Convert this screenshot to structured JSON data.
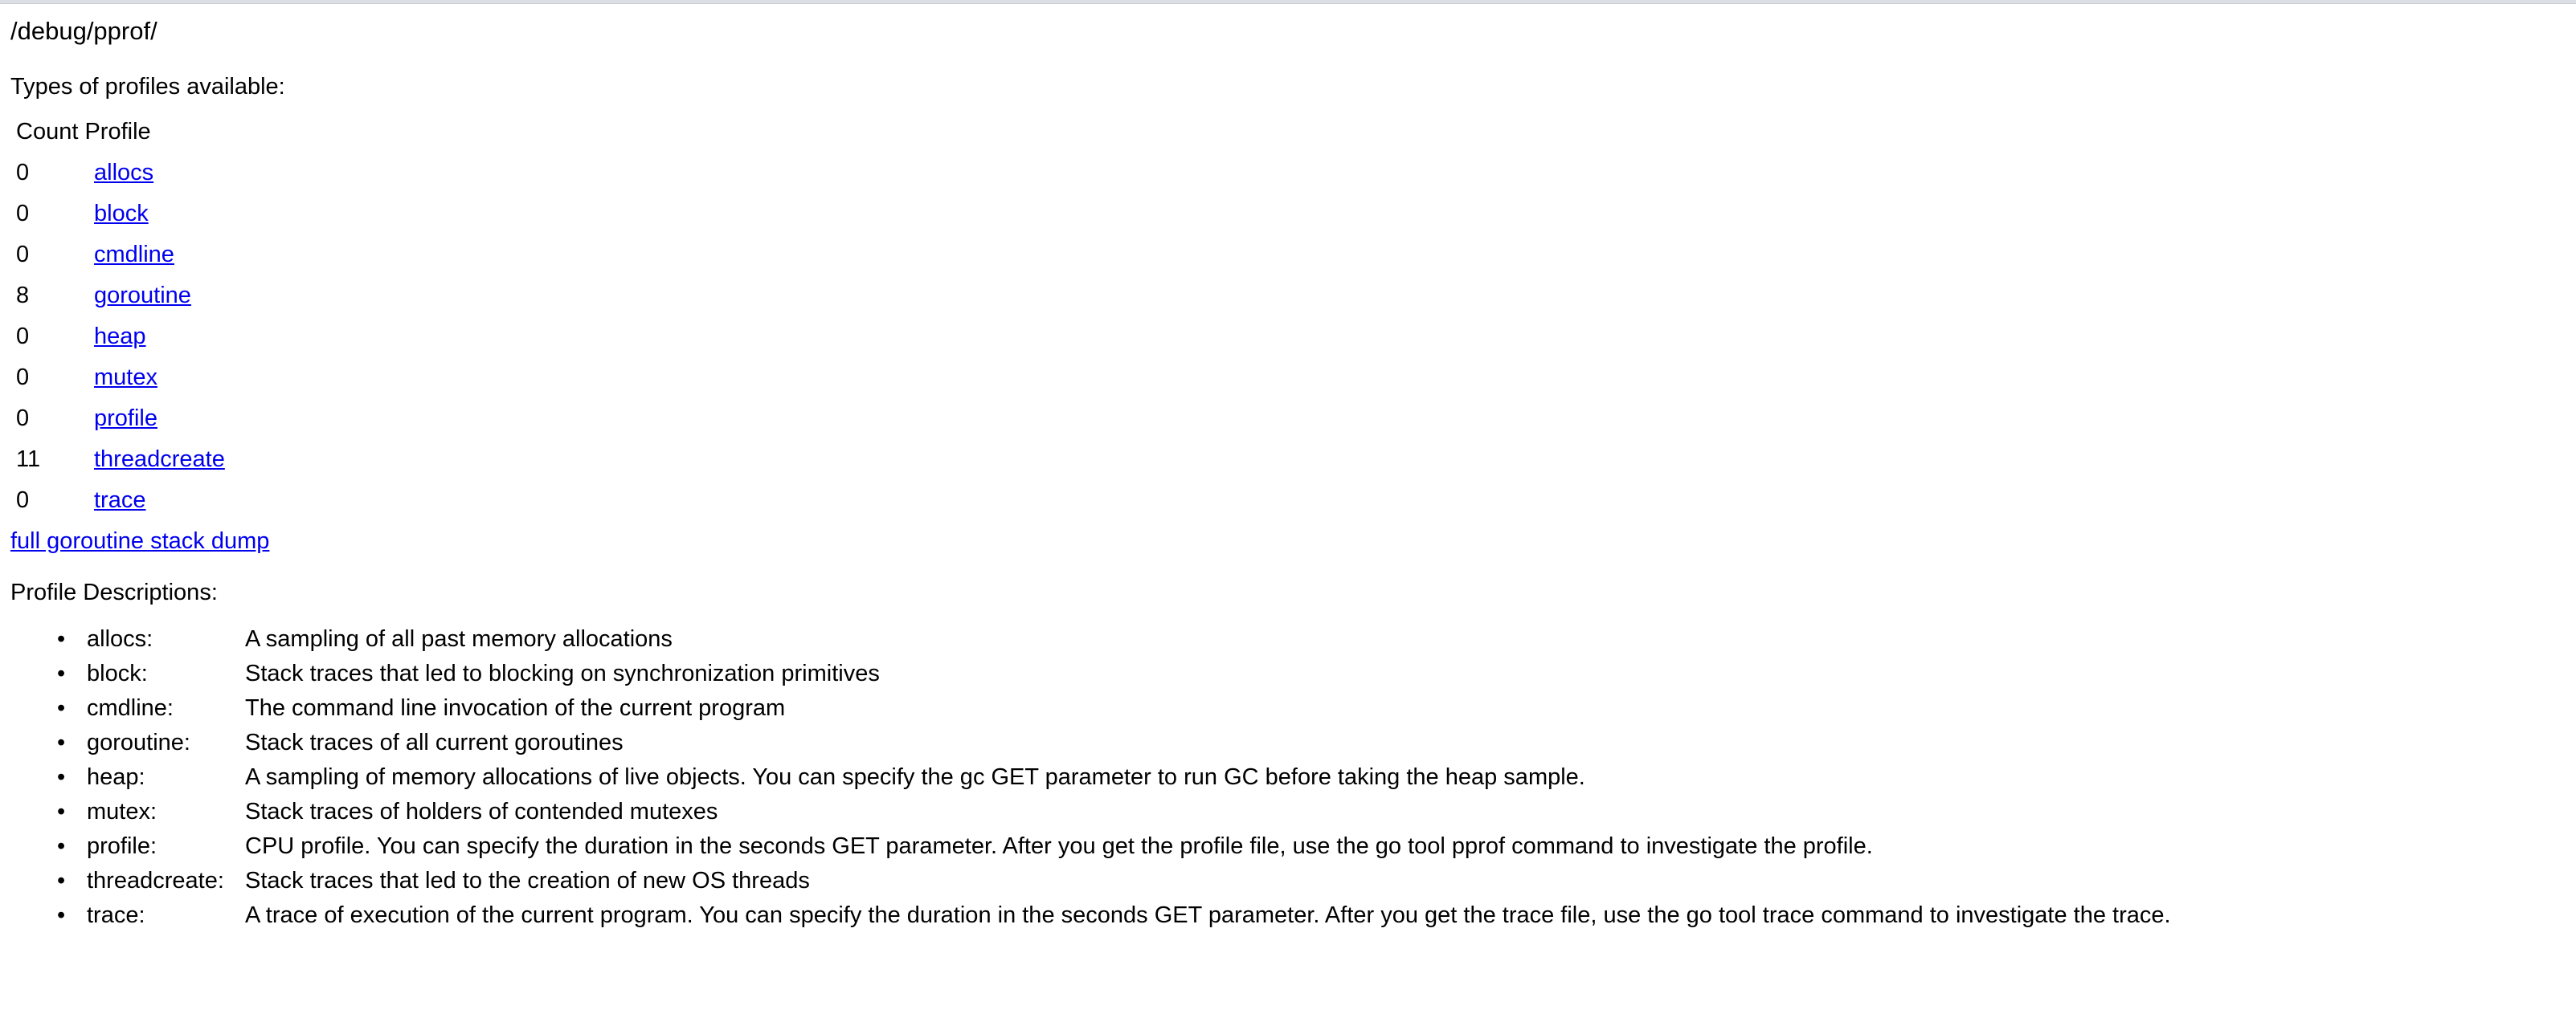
{
  "page": {
    "heading": "/debug/pprof/",
    "types_label": "Types of profiles available:",
    "descriptions_label": "Profile Descriptions:"
  },
  "profile_table": {
    "header": "Count Profile",
    "rows": [
      {
        "count": "0",
        "profile": "allocs"
      },
      {
        "count": "0",
        "profile": "block"
      },
      {
        "count": "0",
        "profile": "cmdline"
      },
      {
        "count": "8",
        "profile": "goroutine"
      },
      {
        "count": "0",
        "profile": "heap"
      },
      {
        "count": "0",
        "profile": "mutex"
      },
      {
        "count": "0",
        "profile": "profile"
      },
      {
        "count": "11",
        "profile": "threadcreate"
      },
      {
        "count": "0",
        "profile": "trace"
      }
    ],
    "stack_dump_link": "full goroutine stack dump"
  },
  "descriptions": [
    {
      "bullet": "•",
      "term": "allocs:",
      "text": "A sampling of all past memory allocations"
    },
    {
      "bullet": "•",
      "term": "block:",
      "text": "Stack traces that led to blocking on synchronization primitives"
    },
    {
      "bullet": "•",
      "term": "cmdline:",
      "text": "The command line invocation of the current program"
    },
    {
      "bullet": "•",
      "term": "goroutine:",
      "text": "Stack traces of all current goroutines"
    },
    {
      "bullet": "•",
      "term": "heap:",
      "text": "A sampling of memory allocations of live objects. You can specify the gc GET parameter to run GC before taking the heap sample."
    },
    {
      "bullet": "•",
      "term": "mutex:",
      "text": "Stack traces of holders of contended mutexes"
    },
    {
      "bullet": "•",
      "term": "profile:",
      "text": "CPU profile. You can specify the duration in the seconds GET parameter. After you get the profile file, use the go tool pprof command to investigate the profile."
    },
    {
      "bullet": "•",
      "term": "threadcreate:",
      "text": "Stack traces that led to the creation of new OS threads"
    },
    {
      "bullet": "•",
      "term": "trace:",
      "text": "A trace of execution of the current program. You can specify the duration in the seconds GET parameter. After you get the trace file, use the go tool trace command to investigate the trace."
    }
  ],
  "colors": {
    "link": "#0000ee",
    "text": "#000000",
    "background": "#ffffff",
    "chrome_edge": "#dcdee5"
  }
}
